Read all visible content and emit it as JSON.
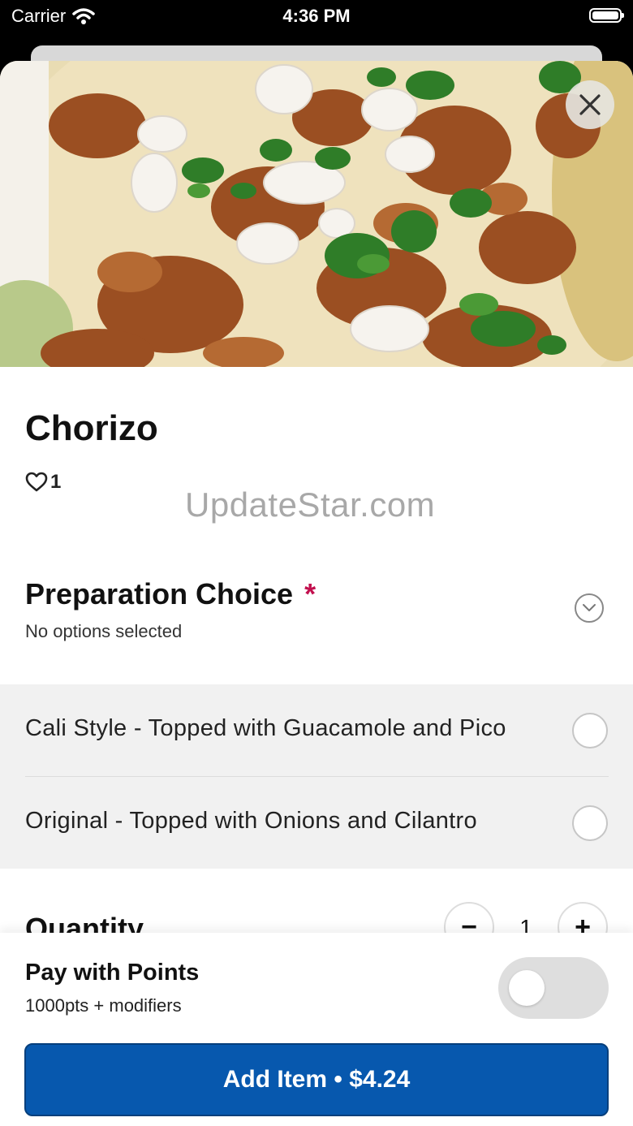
{
  "status_bar": {
    "carrier": "Carrier",
    "time": "4:36 PM"
  },
  "item": {
    "title": "Chorizo",
    "likes": "1"
  },
  "watermark": "UpdateStar.com",
  "preparation": {
    "title": "Preparation Choice",
    "required_mark": "*",
    "subtitle": "No options selected",
    "options": [
      {
        "label": "Cali Style - Topped with Guacamole and Pico"
      },
      {
        "label": "Original - Topped with Onions and Cilantro"
      }
    ]
  },
  "quantity": {
    "label": "Quantity",
    "value": "1",
    "decrement": "−",
    "increment": "+"
  },
  "points": {
    "title": "Pay with Points",
    "subtitle": "1000pts + modifiers",
    "enabled": false
  },
  "add_button": {
    "label": "Add Item • $4.24"
  },
  "colors": {
    "primary": "#0758ae",
    "required": "#c2104e",
    "options_bg": "#f1f1f1"
  }
}
